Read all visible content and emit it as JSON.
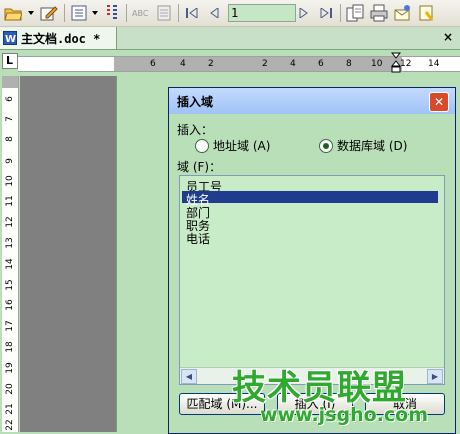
{
  "toolbar": {
    "page_value": "1",
    "icons": [
      "open-folder-icon",
      "edit-icon",
      "list-icon",
      "mail-merge-icon",
      "abc-icon",
      "view-icon",
      "first-record-icon",
      "previous-record-icon",
      "next-record-icon",
      "last-record-icon",
      "merge-to-document-icon",
      "merge-to-printer-icon",
      "merge-to-email-icon",
      "find-record-icon"
    ]
  },
  "tab": {
    "title": "主文档.doc *",
    "close": "×"
  },
  "ruler": {
    "corner": "L",
    "h_numbers": [
      "6",
      "4",
      "2",
      "2",
      "4",
      "6",
      "8",
      "10",
      "12",
      "14"
    ],
    "v_numbers": [
      "6",
      "7",
      "8",
      "9",
      "10",
      "11",
      "12",
      "13",
      "14",
      "15",
      "16",
      "17",
      "18",
      "19",
      "20",
      "21",
      "22"
    ]
  },
  "dialog": {
    "title": "插入域",
    "close_glyph": "✕",
    "insert_label": "插入：",
    "option_address": "地址域 (A)",
    "option_database": "数据库域 (D)",
    "selected_option": "database",
    "fields_label": "域 (F)：",
    "fields": [
      "员工号",
      "姓名",
      "部门",
      "职务",
      "电话"
    ],
    "selected_field": "姓名",
    "buttons": {
      "match": "匹配域 (M)...",
      "insert": "插入 (I)",
      "cancel": "取消"
    }
  },
  "watermark": {
    "brand": "技术员联盟",
    "url": "www.jsgho.com"
  },
  "colors": {
    "page_bg": "#b9dfb9",
    "selection": "#1f3c8f",
    "title_bar": "#9fc2f6",
    "watermark": "#2faa2f"
  }
}
